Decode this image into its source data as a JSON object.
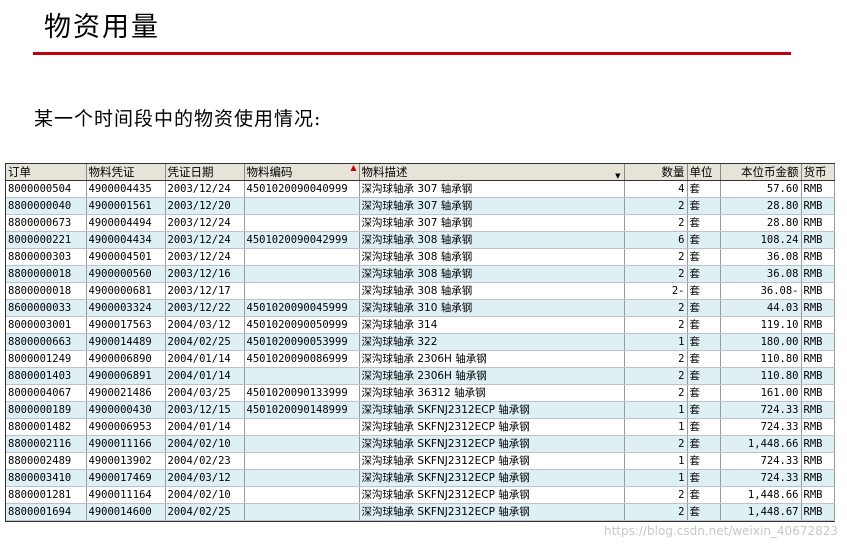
{
  "page": {
    "title": "物资用量",
    "subtitle": "某一个时间段中的物资使用情况:",
    "watermark": "https://blog.csdn.net/weixin_40672823"
  },
  "colors": {
    "accent": "#c0000f",
    "row_alt": "#dff0f5",
    "header_bg": "#e6e3d8"
  },
  "table": {
    "columns": [
      "订单",
      "物料凭证",
      "凭证日期",
      "物料编码",
      "物料描述",
      "数量",
      "单位",
      "本位币金额",
      "货币"
    ],
    "rows": [
      [
        "8000000504",
        "4900004435",
        "2003/12/24",
        "4501020090040999",
        "深沟球轴承 307 轴承钢",
        "4",
        "套",
        "57.60",
        "RMB"
      ],
      [
        "8800000040",
        "4900001561",
        "2003/12/20",
        "",
        "深沟球轴承 307 轴承钢",
        "2",
        "套",
        "28.80",
        "RMB"
      ],
      [
        "8800000673",
        "4900004494",
        "2003/12/24",
        "",
        "深沟球轴承 307 轴承钢",
        "2",
        "套",
        "28.80",
        "RMB"
      ],
      [
        "8000000221",
        "4900004434",
        "2003/12/24",
        "4501020090042999",
        "深沟球轴承 308 轴承钢",
        "6",
        "套",
        "108.24",
        "RMB"
      ],
      [
        "8800000303",
        "4900004501",
        "2003/12/24",
        "",
        "深沟球轴承 308 轴承钢",
        "2",
        "套",
        "36.08",
        "RMB"
      ],
      [
        "8800000018",
        "4900000560",
        "2003/12/16",
        "",
        "深沟球轴承 308 轴承钢",
        "2",
        "套",
        "36.08",
        "RMB"
      ],
      [
        "8800000018",
        "4900000681",
        "2003/12/17",
        "",
        "深沟球轴承 308 轴承钢",
        "2-",
        "套",
        "36.08-",
        "RMB"
      ],
      [
        "8600000033",
        "4900003324",
        "2003/12/22",
        "4501020090045999",
        "深沟球轴承 310 轴承钢",
        "2",
        "套",
        "44.03",
        "RMB"
      ],
      [
        "8000003001",
        "4900017563",
        "2004/03/12",
        "4501020090050999",
        "深沟球轴承 314",
        "2",
        "套",
        "119.10",
        "RMB"
      ],
      [
        "8800000663",
        "4900014489",
        "2004/02/25",
        "4501020090053999",
        "深沟球轴承 322",
        "1",
        "套",
        "180.00",
        "RMB"
      ],
      [
        "8000001249",
        "4900006890",
        "2004/01/14",
        "4501020090086999",
        "深沟球轴承 2306H 轴承钢",
        "2",
        "套",
        "110.80",
        "RMB"
      ],
      [
        "8800001403",
        "4900006891",
        "2004/01/14",
        "",
        "深沟球轴承 2306H 轴承钢",
        "2",
        "套",
        "110.80",
        "RMB"
      ],
      [
        "8000004067",
        "4900021486",
        "2004/03/25",
        "4501020090133999",
        "深沟球轴承 36312 轴承钢",
        "2",
        "套",
        "161.00",
        "RMB"
      ],
      [
        "8000000189",
        "4900000430",
        "2003/12/15",
        "4501020090148999",
        "深沟球轴承 SKFNJ2312ECP 轴承钢",
        "1",
        "套",
        "724.33",
        "RMB"
      ],
      [
        "8800001482",
        "4900006953",
        "2004/01/14",
        "",
        "深沟球轴承 SKFNJ2312ECP 轴承钢",
        "1",
        "套",
        "724.33",
        "RMB"
      ],
      [
        "8800002116",
        "4900011166",
        "2004/02/10",
        "",
        "深沟球轴承 SKFNJ2312ECP 轴承钢",
        "2",
        "套",
        "1,448.66",
        "RMB"
      ],
      [
        "8800002489",
        "4900013902",
        "2004/02/23",
        "",
        "深沟球轴承 SKFNJ2312ECP 轴承钢",
        "1",
        "套",
        "724.33",
        "RMB"
      ],
      [
        "8800003410",
        "4900017469",
        "2004/03/12",
        "",
        "深沟球轴承 SKFNJ2312ECP 轴承钢",
        "1",
        "套",
        "724.33",
        "RMB"
      ],
      [
        "8800001281",
        "4900011164",
        "2004/02/10",
        "",
        "深沟球轴承 SKFNJ2312ECP 轴承钢",
        "2",
        "套",
        "1,448.66",
        "RMB"
      ],
      [
        "8800001694",
        "4900014600",
        "2004/02/25",
        "",
        "深沟球轴承 SKFNJ2312ECP 轴承钢",
        "2",
        "套",
        "1,448.67",
        "RMB"
      ]
    ]
  }
}
